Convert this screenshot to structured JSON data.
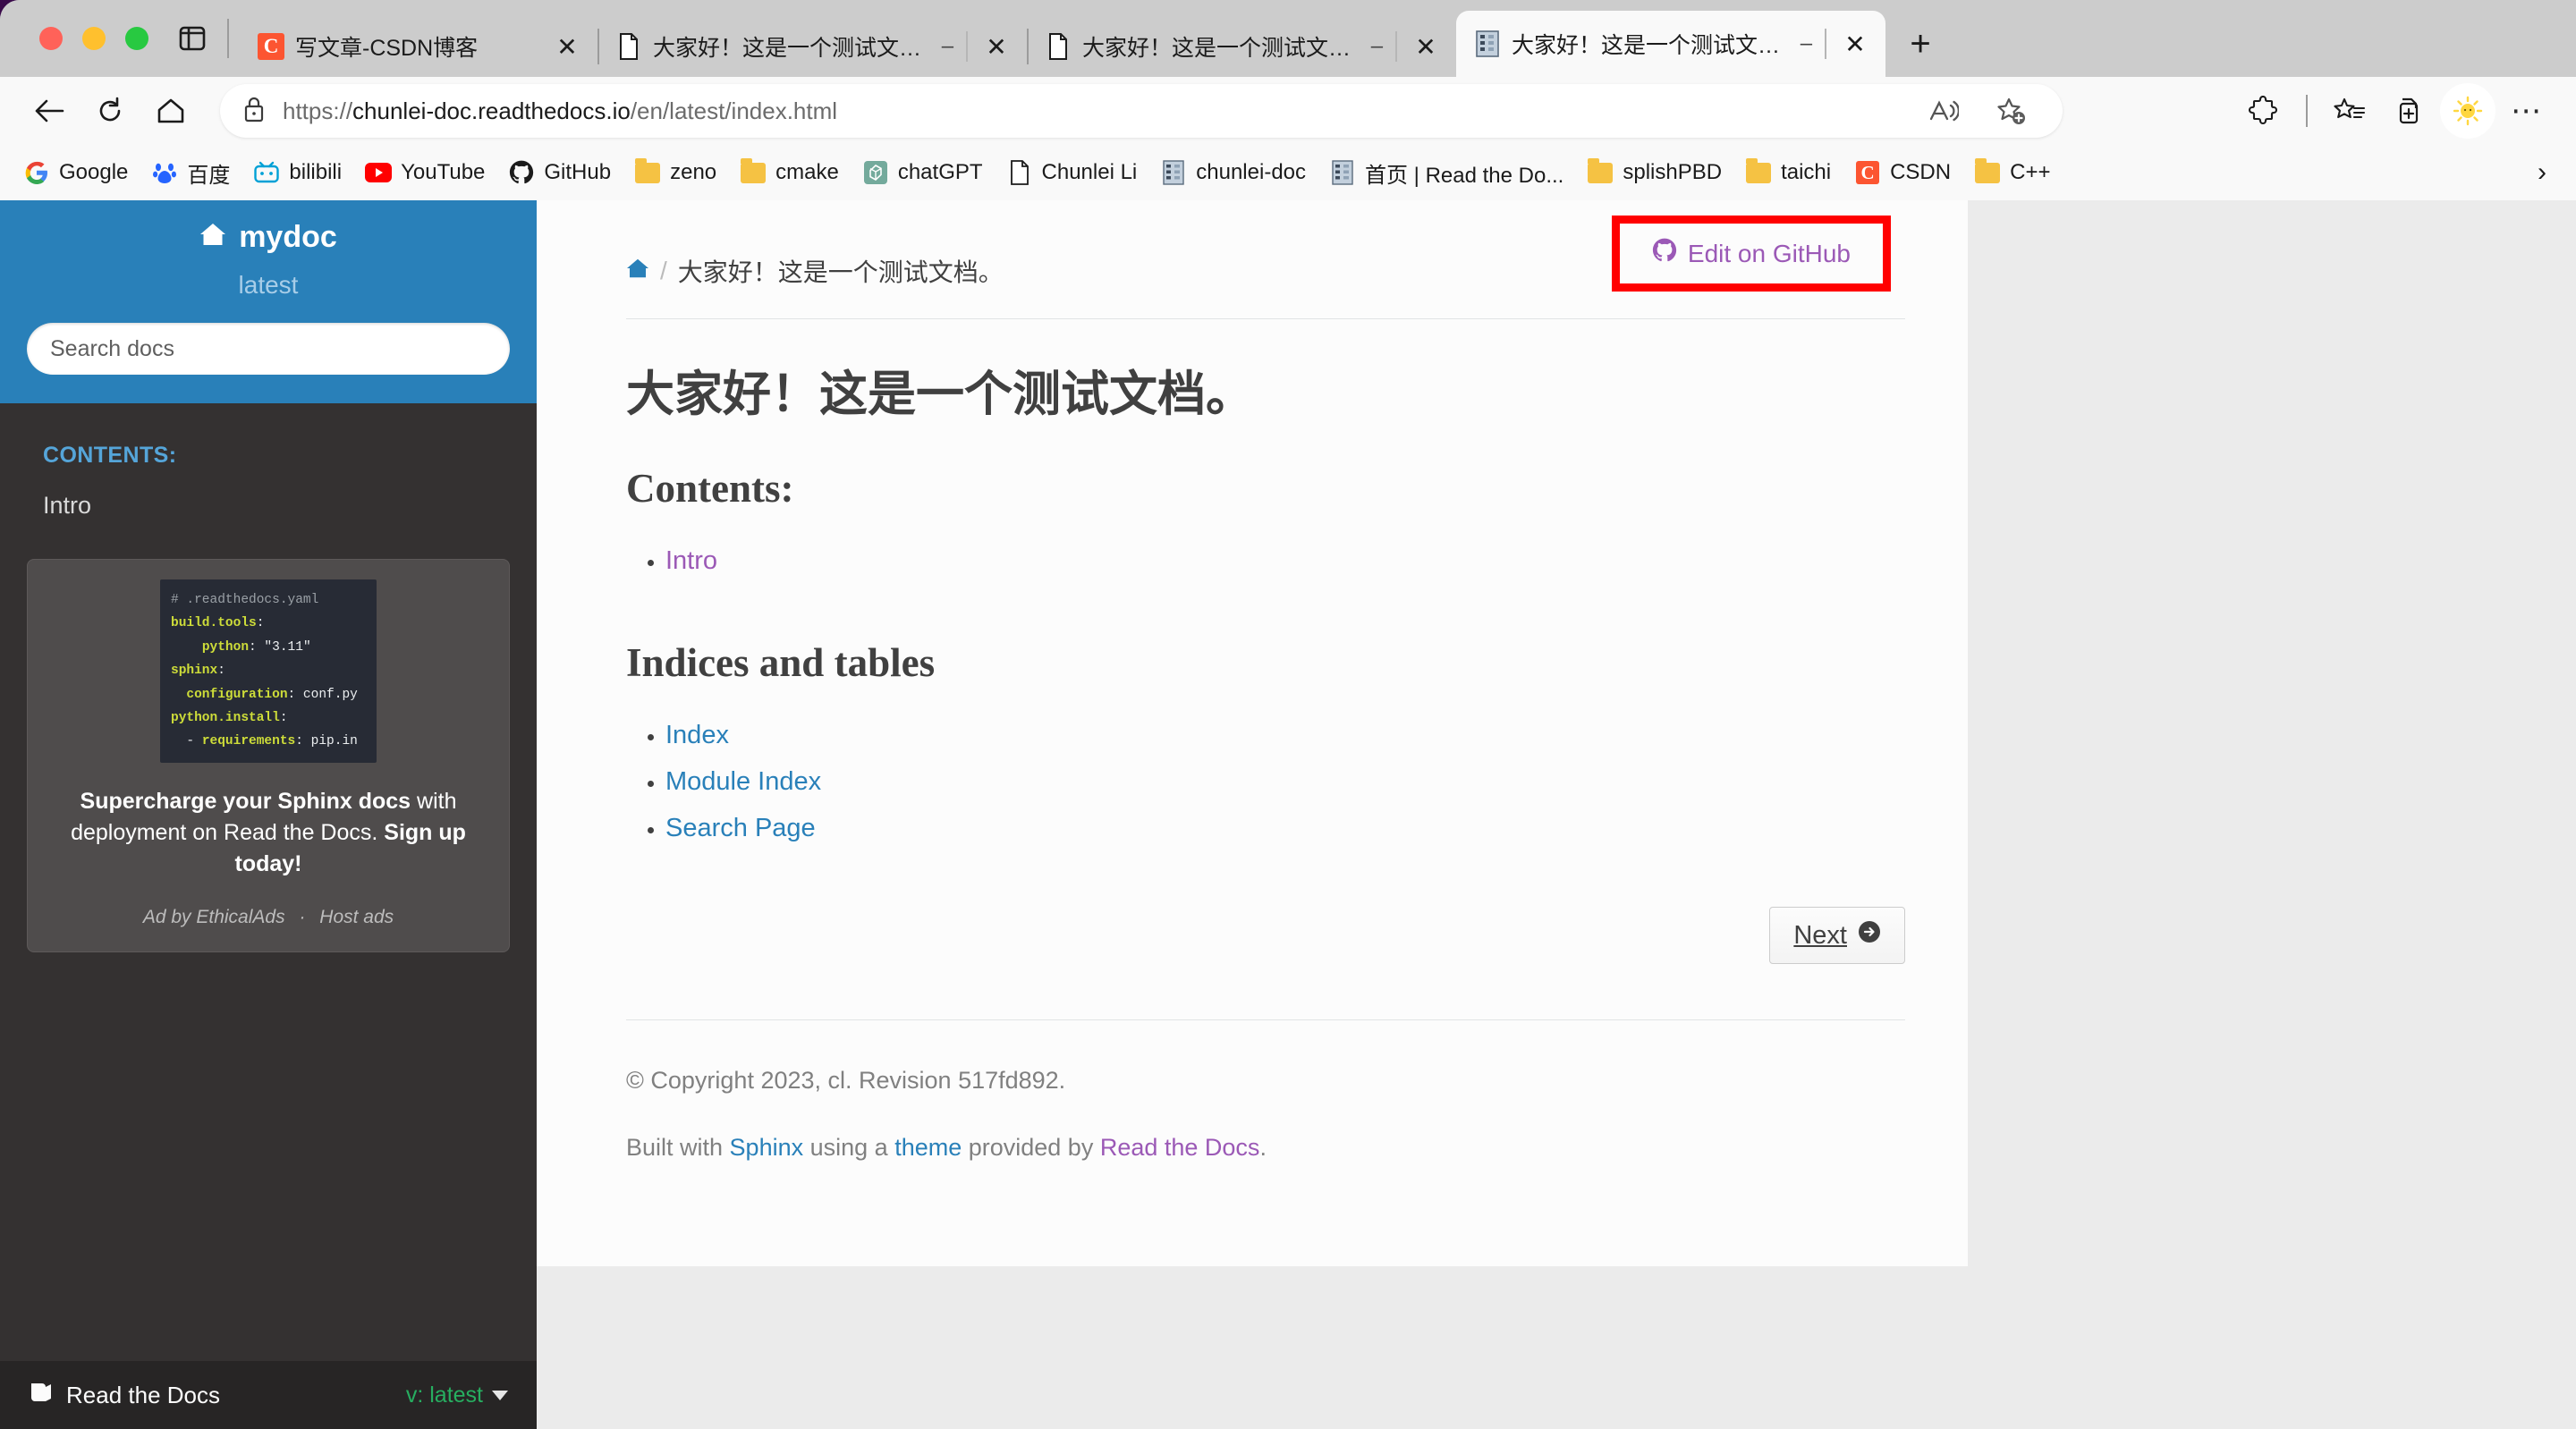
{
  "window": {
    "traffic_lights": [
      "close",
      "minimize",
      "maximize"
    ],
    "sidebar_toggle_icon": "panel-icon"
  },
  "tabs": [
    {
      "title": "写文章-CSDN博客",
      "favicon": "csdn-icon",
      "active": false,
      "muted": false
    },
    {
      "title": "大家好！这是一个测试文档。",
      "favicon": "document-icon",
      "active": false,
      "muted": true
    },
    {
      "title": "大家好！这是一个测试文档。",
      "favicon": "document-icon",
      "active": false,
      "muted": true
    },
    {
      "title": "大家好！这是一个测试文档。",
      "favicon": "readthedocs-icon",
      "active": true,
      "muted": true
    }
  ],
  "new_tab_label": "+",
  "toolbar": {
    "back_icon": "back-arrow-icon",
    "reload_icon": "reload-icon",
    "home_icon": "home-icon",
    "lock_icon": "lock-icon",
    "url_prefix": "https://",
    "url_host": "chunlei-doc.readthedocs.io",
    "url_path": "/en/latest/index.html",
    "url_full": "https://chunlei-doc.readthedocs.io/en/latest/index.html",
    "read_aloud_icon": "read-aloud-icon",
    "add_favorite_icon": "add-favorite-icon",
    "extensions_icon": "extensions-icon",
    "collections_icon": "collections-icon",
    "split_screen_icon": "split-screen-icon",
    "weather_icon": "sun-icon",
    "settings_icon": "more-options-icon"
  },
  "bookmarks": {
    "items": [
      {
        "label": "Google",
        "icon": "google-icon"
      },
      {
        "label": "百度",
        "icon": "baidu-icon"
      },
      {
        "label": "bilibili",
        "icon": "bilibili-icon"
      },
      {
        "label": "YouTube",
        "icon": "youtube-icon"
      },
      {
        "label": "GitHub",
        "icon": "github-icon"
      },
      {
        "label": "zeno",
        "icon": "folder-icon"
      },
      {
        "label": "cmake",
        "icon": "folder-icon"
      },
      {
        "label": "chatGPT",
        "icon": "chatgpt-icon"
      },
      {
        "label": "Chunlei Li",
        "icon": "document-icon"
      },
      {
        "label": "chunlei-doc",
        "icon": "readthedocs-icon"
      },
      {
        "label": "首页 | Read the Do...",
        "icon": "readthedocs-icon"
      },
      {
        "label": "splishPBD",
        "icon": "folder-icon"
      },
      {
        "label": "taichi",
        "icon": "folder-icon"
      },
      {
        "label": "CSDN",
        "icon": "csdn-icon"
      },
      {
        "label": "C++",
        "icon": "folder-icon"
      }
    ],
    "overflow_icon": "chevron-right-icon"
  },
  "sidebar": {
    "brand": "mydoc",
    "brand_icon": "home-icon",
    "version": "latest",
    "search_placeholder": "Search docs",
    "search_value": "",
    "contents_caption": "CONTENTS:",
    "toc": [
      {
        "label": "Intro"
      }
    ],
    "ad": {
      "code_lines": [
        {
          "text": "# .readthedocs.yaml",
          "style": "comment"
        },
        {
          "text": "build.tools:",
          "style": "key"
        },
        {
          "text": "    python: \"3.11\"",
          "style": "key"
        },
        {
          "text": "sphinx:",
          "style": "key"
        },
        {
          "text": "  configuration: conf.py",
          "style": "key"
        },
        {
          "text": "python.install:",
          "style": "key"
        },
        {
          "text": "  - requirements: pip.in",
          "style": "key"
        }
      ],
      "code_raw": "# .readthedocs.yaml\nbuild.tools:\n    python: \"3.11\"\nsphinx:\n  configuration: conf.py\npython.install:\n  - requirements: pip.in",
      "headline_bold_1": "Supercharge your Sphinx docs",
      "headline_mid": " with deployment on Read the Docs. ",
      "headline_bold_2": "Sign up today!",
      "by_label": "Ad by EthicalAds",
      "sep": "·",
      "host_label": "Host ads"
    },
    "footer": {
      "brand": "Read the Docs",
      "brand_icon": "book-icon",
      "version_label": "v: latest",
      "caret_icon": "chevron-down-icon"
    }
  },
  "main": {
    "breadcrumb_home_icon": "home-icon",
    "breadcrumb_sep": "/",
    "breadcrumb_current": "大家好！这是一个测试文档。",
    "edit_on_github": "Edit on GitHub",
    "edit_github_icon": "github-icon",
    "highlight_color": "#ff0000",
    "page_title": "大家好！这是一个测试文档。",
    "contents_heading": "Contents:",
    "contents_links": [
      {
        "label": "Intro",
        "state": "visited"
      }
    ],
    "indices_heading": "Indices and tables",
    "indices_links": [
      {
        "label": "Index",
        "state": "unvisited"
      },
      {
        "label": "Module Index",
        "state": "unvisited"
      },
      {
        "label": "Search Page",
        "state": "unvisited"
      }
    ],
    "next_button": "Next",
    "next_icon": "arrow-right-circle-icon",
    "copyright": "© Copyright 2023, cl. Revision 517fd892.",
    "built_with_prefix": "Built with ",
    "sphinx_link": "Sphinx",
    "built_with_mid": " using a ",
    "theme_link": "theme",
    "built_with_mid2": " provided by ",
    "rtd_link": "Read the Docs",
    "built_with_end": "."
  },
  "colors": {
    "sidebar_header": "#2980b9",
    "sidebar_body": "#343131",
    "link_blue": "#2980b9",
    "link_visited_purple": "#9b59b6",
    "version_green": "#27ae60",
    "highlight_red": "#ff0000"
  }
}
